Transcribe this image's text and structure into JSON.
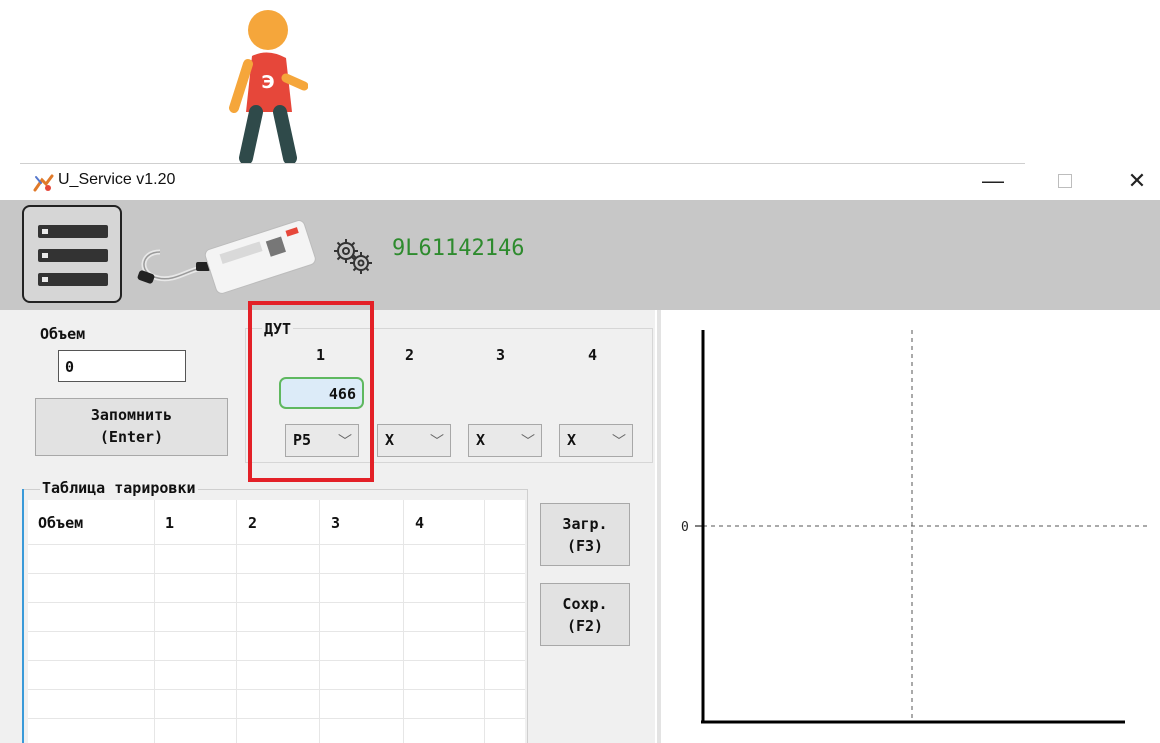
{
  "window": {
    "title": "U_Service v1.20",
    "minimize": "—",
    "close": "✕"
  },
  "mascot": {
    "badge": "Э"
  },
  "header": {
    "serial": "9L61142146",
    "serial_color": "#2e8b2e"
  },
  "volume": {
    "label": "Объем",
    "value": "0",
    "save_label_line1": "Запомнить",
    "save_label_line2": "(Enter)"
  },
  "dut": {
    "label": "ДУТ",
    "columns": [
      "1",
      "2",
      "3",
      "4"
    ],
    "level_value": "466",
    "selects": [
      "P5",
      "X",
      "X",
      "X"
    ]
  },
  "calibration_table": {
    "label": "Таблица тарировки",
    "headers": [
      "Объем",
      "1",
      "2",
      "3",
      "4",
      ""
    ]
  },
  "buttons": {
    "load_line1": "Загр.",
    "load_line2": "(F3)",
    "save_line1": "Сохр.",
    "save_line2": "(F2)"
  },
  "chart": {
    "y_tick": "0"
  },
  "highlight_color": "#e32027"
}
